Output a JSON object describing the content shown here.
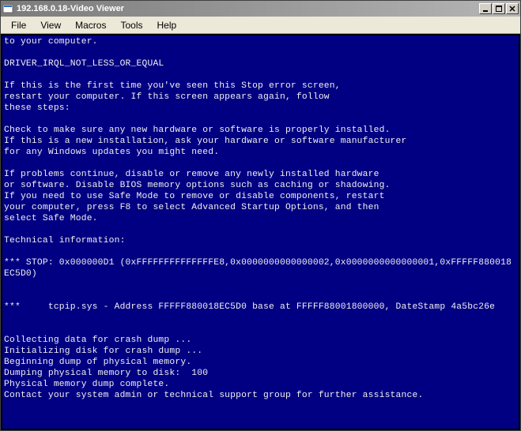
{
  "window": {
    "title": "192.168.0.18-Video Viewer"
  },
  "menu": {
    "file": "File",
    "view": "View",
    "macros": "Macros",
    "tools": "Tools",
    "help": "Help"
  },
  "bsod": {
    "line1": "to your computer.",
    "error_code": "DRIVER_IRQL_NOT_LESS_OR_EQUAL",
    "instr1": "If this is the first time you've seen this Stop error screen,",
    "instr2": "restart your computer. If this screen appears again, follow",
    "instr3": "these steps:",
    "check1": "Check to make sure any new hardware or software is properly installed.",
    "check2": "If this is a new installation, ask your hardware or software manufacturer",
    "check3": "for any Windows updates you might need.",
    "prob1": "If problems continue, disable or remove any newly installed hardware",
    "prob2": "or software. Disable BIOS memory options such as caching or shadowing.",
    "prob3": "If you need to use Safe Mode to remove or disable components, restart",
    "prob4": "your computer, press F8 to select Advanced Startup Options, and then",
    "prob5": "select Safe Mode.",
    "tech_header": "Technical information:",
    "stop_line": "*** STOP: 0x000000D1 (0xFFFFFFFFFFFFFFE8,0x0000000000000002,0x0000000000000001,0xFFFFF880018EC5D0)",
    "module_line": "***     tcpip.sys - Address FFFFF880018EC5D0 base at FFFFF88001800000, DateStamp 4a5bc26e",
    "dump1": "Collecting data for crash dump ...",
    "dump2": "Initializing disk for crash dump ...",
    "dump3": "Beginning dump of physical memory.",
    "dump4": "Dumping physical memory to disk:  100",
    "dump5": "Physical memory dump complete.",
    "dump6": "Contact your system admin or technical support group for further assistance."
  }
}
